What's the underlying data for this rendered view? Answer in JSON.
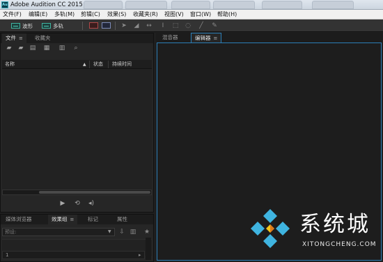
{
  "window": {
    "title": "Adobe Audition CC 2015",
    "icon_text": "Au",
    "background_tabs": [
      "",
      "",
      "",
      "",
      "",
      ""
    ]
  },
  "menu": {
    "items": [
      "文件(F)",
      "编辑(E)",
      "多轨(M)",
      "剪辑(C)",
      "效果(S)",
      "收藏夹(R)",
      "视图(V)",
      "窗口(W)",
      "帮助(H)"
    ]
  },
  "toolbar": {
    "waveform_label": "波形",
    "multitrack_label": "多轨",
    "tool_icons": [
      "spectral-frequency-icon",
      "spectral-pitch-icon",
      "move-tool-icon",
      "razor-tool-icon",
      "slip-tool-icon",
      "time-selection-icon",
      "marquee-selection-icon",
      "lasso-selection-icon",
      "brush-selection-icon",
      "spot-healing-icon"
    ]
  },
  "files_panel": {
    "tabs": [
      {
        "label": "文件",
        "active": true
      },
      {
        "label": "收藏夹",
        "active": false
      }
    ],
    "tab_menu": "≡",
    "columns": {
      "name": "名称",
      "sort_arrow": "▲",
      "status": "状态",
      "duration": "持续时间"
    },
    "tool_icons": [
      "open-file-icon",
      "import-file-icon",
      "new-file-icon",
      "insert-into-multitrack-icon",
      "delete-icon",
      "search-icon"
    ]
  },
  "effects_panel": {
    "tabs": [
      {
        "label": "媒体浏览器",
        "active": false
      },
      {
        "label": "效果组",
        "active": true
      },
      {
        "label": "标记",
        "active": false
      },
      {
        "label": "属性",
        "active": false
      }
    ],
    "tab_menu": "≡",
    "preset_label": "预设:",
    "rack_row_number": "1"
  },
  "editor_panel": {
    "tabs": [
      {
        "label": "混音器",
        "active": false
      },
      {
        "label": "编辑器",
        "active": true
      }
    ],
    "tab_menu": "≡",
    "accent_color": "#2c7fb8"
  },
  "watermark": {
    "text": "系统城",
    "subtext": "XITONGCHENG.COM"
  }
}
